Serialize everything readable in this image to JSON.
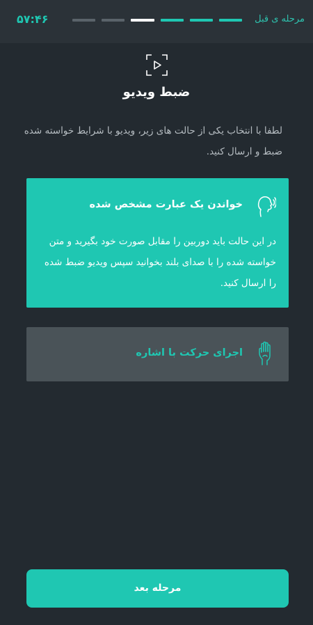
{
  "header": {
    "back_label": "مرحله ی قبل",
    "timer": "۵۷:۴۶",
    "progress_steps": [
      "todo",
      "todo",
      "current",
      "done",
      "done",
      "done"
    ]
  },
  "page": {
    "icon": "video-frame-play-icon",
    "title": "ضبط ویدیو",
    "instructions": "لطفا با انتخاب یکی از حالت های زیر، ویدیو با شرایط خواسته شده ضبط و ارسال کنید."
  },
  "options": [
    {
      "icon": "speaking-head-icon",
      "title": "خواندن یک عبارت مشخص شده",
      "description": "در این حالت باید دوربین را مقابل صورت خود بگیرید و متن خواسته شده را با صدای بلند بخوانید سپس ویدیو ضبط شده را ارسال کنید.",
      "selected": true
    },
    {
      "icon": "hand-gesture-icon",
      "title": "اجرای حرکت با اشاره",
      "selected": false
    }
  ],
  "footer": {
    "next_label": "مرحله بعد"
  },
  "colors": {
    "background": "#232a30",
    "header": "#2b3238",
    "accent": "#1fc7b2",
    "unselected_card": "#4a5358"
  }
}
